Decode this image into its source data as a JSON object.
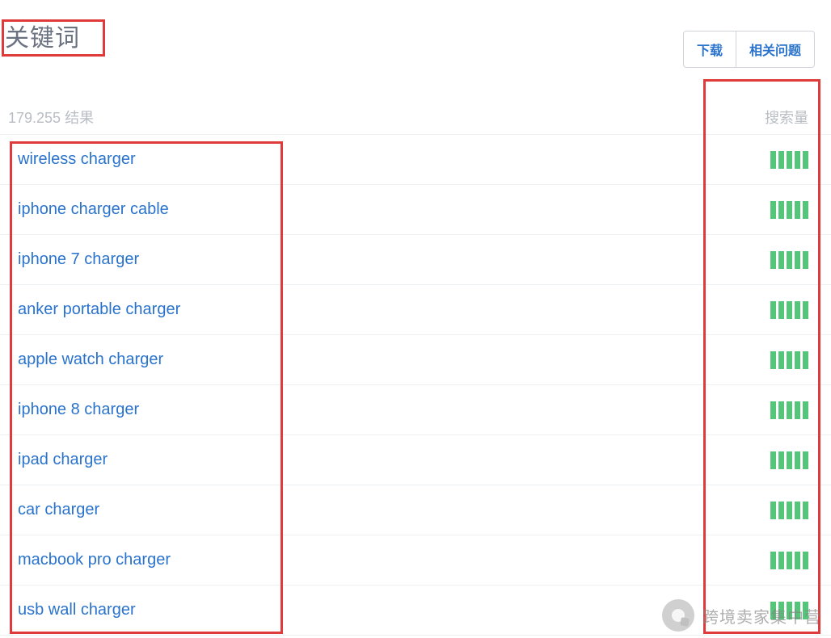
{
  "header": {
    "title": "关键词",
    "download_label": "下载",
    "related_label": "相关问题"
  },
  "subheader": {
    "result_count": "179.255",
    "result_suffix": "结果",
    "volume_label": "搜索量"
  },
  "rows": [
    {
      "keyword": "wireless charger",
      "bars": 5
    },
    {
      "keyword": "iphone charger cable",
      "bars": 5
    },
    {
      "keyword": "iphone 7 charger",
      "bars": 5
    },
    {
      "keyword": "anker portable charger",
      "bars": 5
    },
    {
      "keyword": "apple watch charger",
      "bars": 5
    },
    {
      "keyword": "iphone 8 charger",
      "bars": 5
    },
    {
      "keyword": "ipad charger",
      "bars": 5
    },
    {
      "keyword": "car charger",
      "bars": 5
    },
    {
      "keyword": "macbook pro charger",
      "bars": 5
    },
    {
      "keyword": "usb wall charger",
      "bars": 5
    }
  ],
  "watermark": {
    "text": "跨境卖家集中营"
  }
}
